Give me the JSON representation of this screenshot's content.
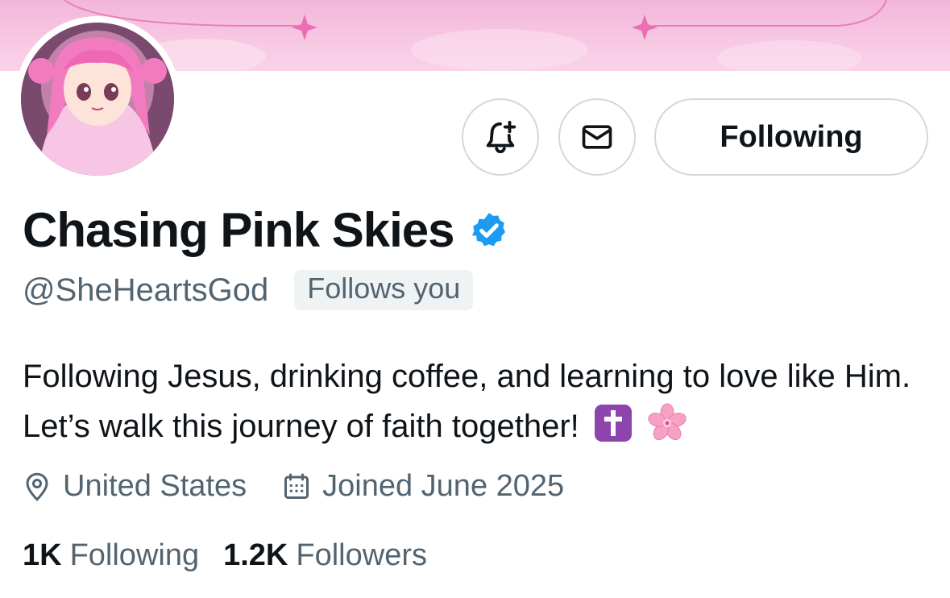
{
  "profile": {
    "display_name": "Chasing Pink Skies",
    "handle": "@SheHeartsGod",
    "follows_you_badge": "Follows you",
    "verified": true,
    "bio": "Following Jesus, drinking coffee, and learning to love like Him. Let’s walk this journey of faith together!",
    "bio_emojis": [
      "latin-cross-emoji",
      "cherry-blossom-emoji"
    ],
    "location": "United States",
    "joined": "Joined June 2025"
  },
  "actions": {
    "notify_icon": "bell-plus-icon",
    "message_icon": "envelope-icon",
    "follow_label": "Following"
  },
  "stats": {
    "following_count": "1K",
    "following_label": "Following",
    "followers_count": "1.2K",
    "followers_label": "Followers"
  },
  "colors": {
    "verified_blue": "#1d9bf0",
    "secondary_text": "#536471",
    "banner_pink": "#f5bedd"
  }
}
